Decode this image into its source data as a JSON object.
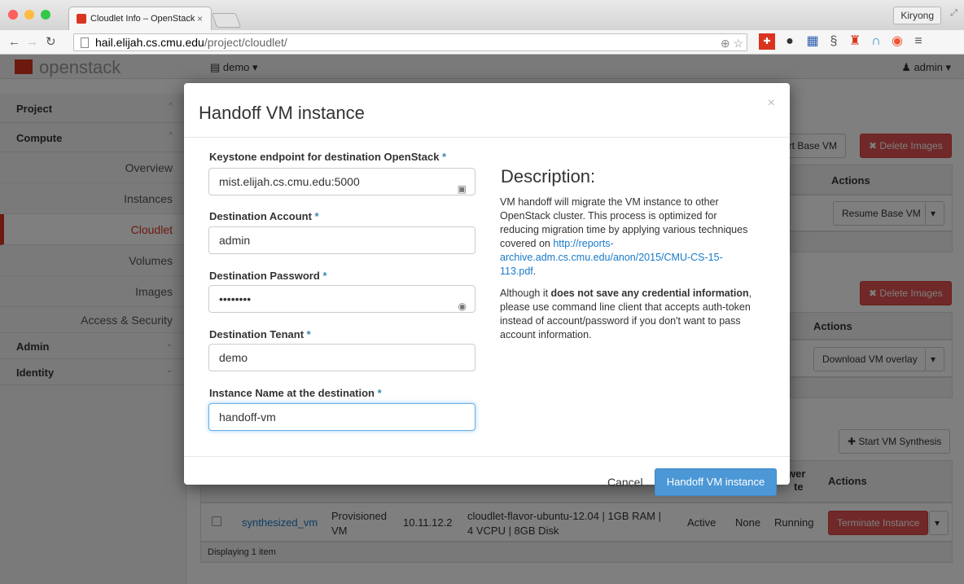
{
  "browser": {
    "tab_title": "Cloudlet Info – OpenStack",
    "tab_close": "×",
    "profile_name": "Kiryong",
    "url_host": "hail.elijah.cs.cmu.edu",
    "url_path": "/project/cloudlet/"
  },
  "header": {
    "logo_text": "openstack",
    "project_selector": "▤ demo ▾",
    "user_menu": "♟ admin ▾"
  },
  "sidebar": {
    "project": "Project",
    "compute": "Compute",
    "items": [
      "Overview",
      "Instances",
      "Cloudlet",
      "Volumes",
      "Images",
      "Access & Security"
    ],
    "admin": "Admin",
    "identity": "Identity"
  },
  "background": {
    "import_base_vm": "ort Base VM",
    "delete_images_1": "✖ Delete Images",
    "actions_1": "Actions",
    "resume_base_vm": "Resume Base VM",
    "delete_images_2": "✖ Delete Images",
    "actions_2": "Actions",
    "download_vm_overlay": "Download VM overlay",
    "start_vm_synthesis": "✚ Start VM Synthesis",
    "col_power_state_1": "wer",
    "col_power_state_2": "te",
    "actions_3": "Actions",
    "row": {
      "name": "synthesized_vm",
      "type_1": "Provisioned",
      "type_2": "VM",
      "ip": "10.11.12.2",
      "flavor_1": "cloudlet-flavor-ubuntu-12.04 | 1GB RAM |",
      "flavor_2": "4 VCPU | 8GB Disk",
      "status": "Active",
      "task": "None",
      "power": "Running",
      "terminate": "Terminate Instance"
    },
    "displaying": "Displaying 1 item"
  },
  "modal": {
    "title": "Handoff VM instance",
    "close": "×",
    "fields": {
      "keystone_label": "Keystone endpoint for destination OpenStack",
      "keystone_value": "mist.elijah.cs.cmu.edu:5000",
      "account_label": "Destination Account",
      "account_value": "admin",
      "password_label": "Destination Password",
      "password_value": "••••••••",
      "tenant_label": "Destination Tenant",
      "tenant_value": "demo",
      "instance_label": "Instance Name at the destination",
      "instance_value": "handoff-vm"
    },
    "required_mark": "*",
    "description": {
      "title": "Description:",
      "p1_text": "VM handoff will migrate the VM instance to other OpenStack cluster. This process is optimized for reducing migration time by applying various techniques covered on ",
      "p1_link": "http://reports-archive.adm.cs.cmu.edu/anon/2015/CMU-CS-15-113.pdf",
      "p1_end": ".",
      "p2_start": "Although it ",
      "p2_bold": "does not save any credential information",
      "p2_end": ", please use command line client that accepts auth-token instead of account/password if you don't want to pass account information."
    },
    "cancel": "Cancel",
    "submit": "Handoff VM instance"
  },
  "colors": {
    "brand_red": "#d9341f",
    "primary_blue": "#4c98d6",
    "danger_red": "#e05151",
    "link_blue": "#1a7bc9"
  }
}
